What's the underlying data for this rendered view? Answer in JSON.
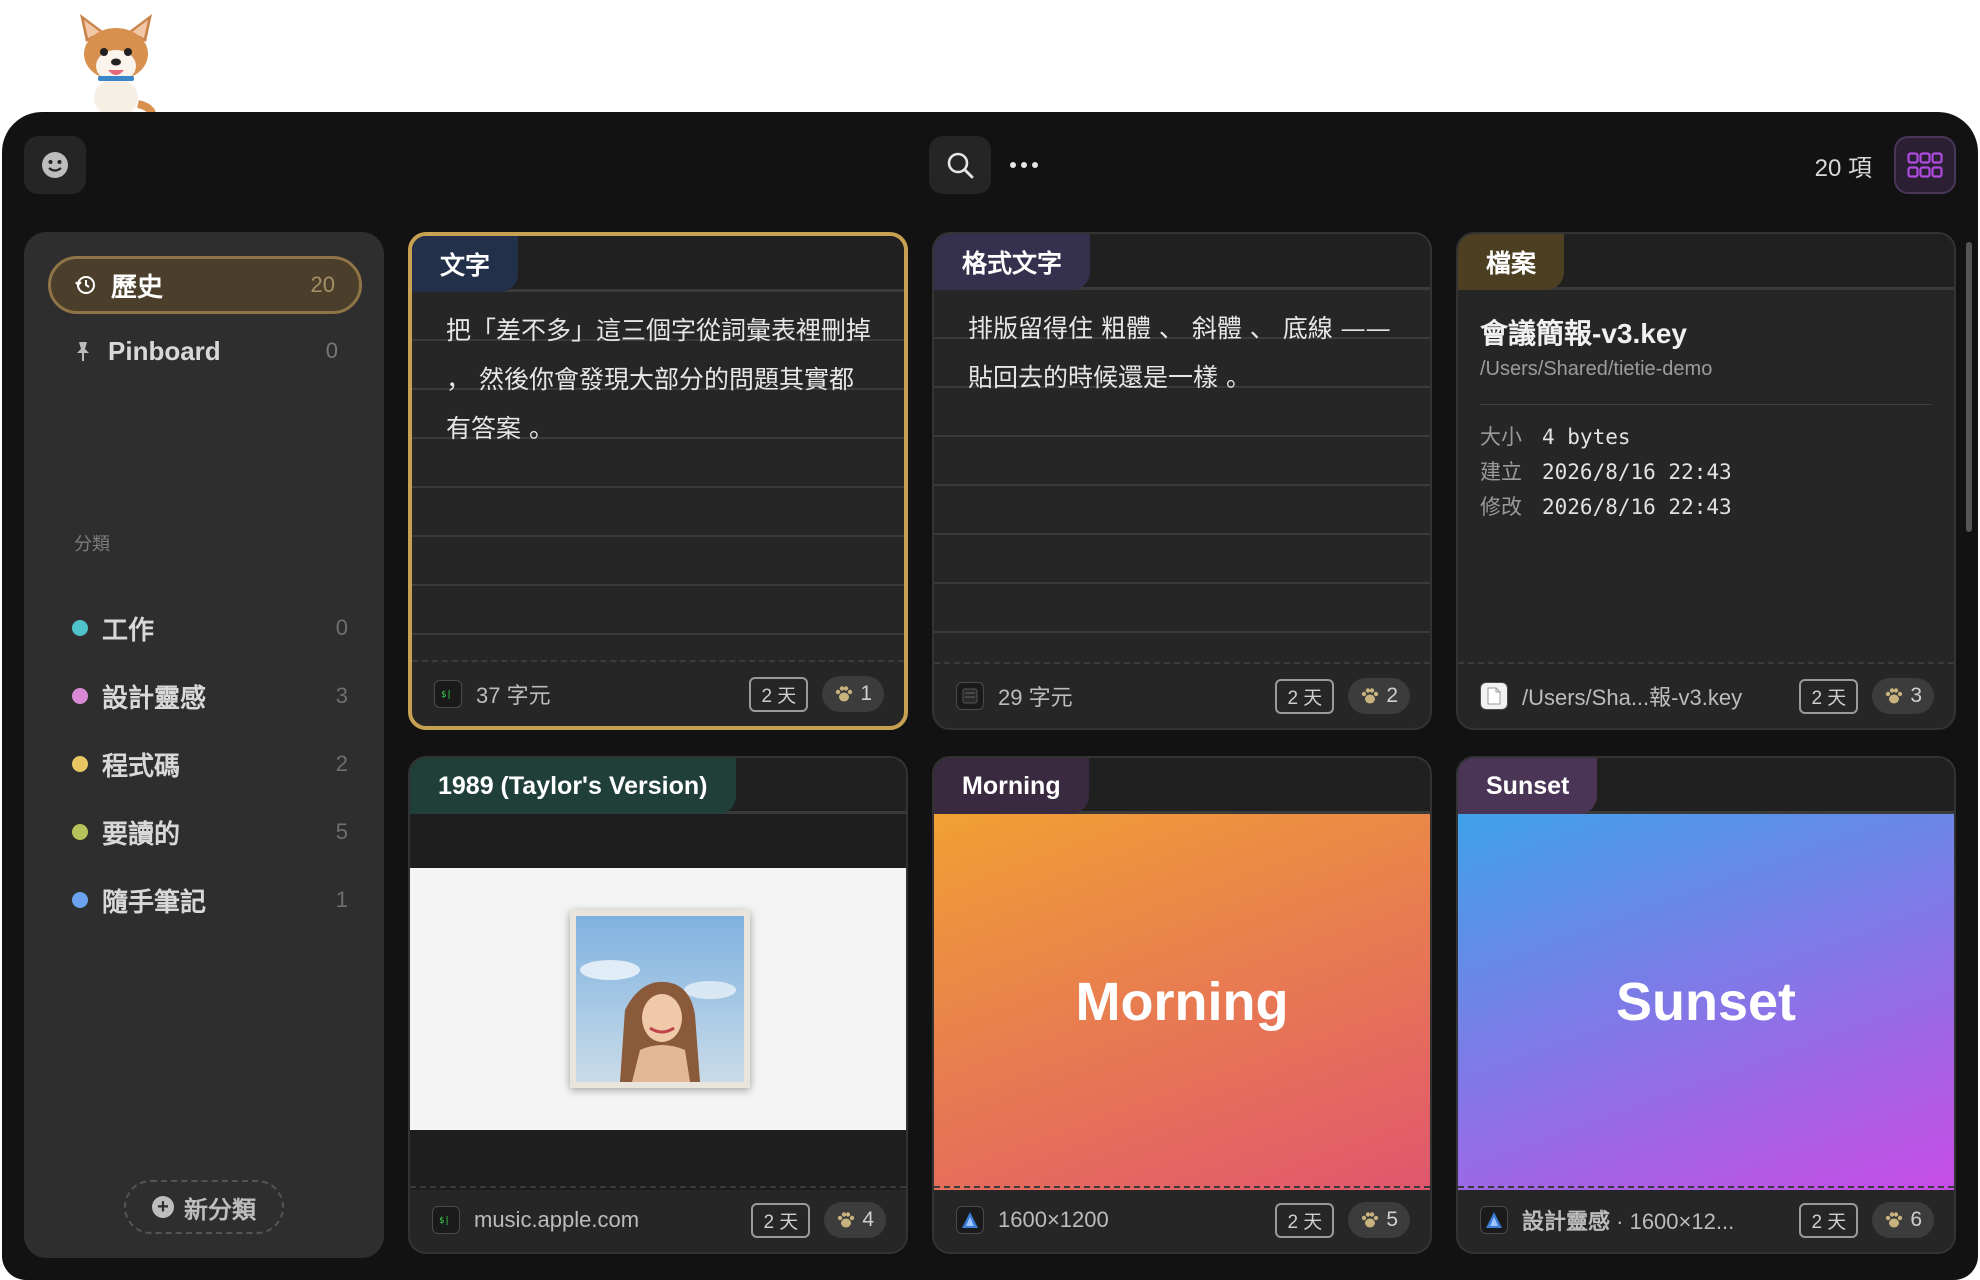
{
  "toolbar": {
    "item_count": "20 項"
  },
  "sidebar": {
    "history": {
      "label": "歷史",
      "count": "20"
    },
    "pinboard": {
      "label": "Pinboard",
      "count": "0"
    },
    "section_title": "分類",
    "categories": [
      {
        "label": "工作",
        "count": "0",
        "color": "#4fc3c9"
      },
      {
        "label": "設計靈感",
        "count": "3",
        "color": "#d98ad6"
      },
      {
        "label": "程式碼",
        "count": "2",
        "color": "#e8c463"
      },
      {
        "label": "要讀的",
        "count": "5",
        "color": "#b6c25a"
      },
      {
        "label": "隨手筆記",
        "count": "1",
        "color": "#6aa2ef"
      }
    ],
    "new_category": "新分類"
  },
  "cards": [
    {
      "tag": "文字",
      "tag_color": "#223049",
      "text": "把「差不多」這三個字從詞彙表裡刪掉 ， 然後你會發現大部分的問題其實都有答案 。",
      "foot": "37 字元",
      "age": "2 天",
      "paws": "1"
    },
    {
      "tag": "格式文字",
      "tag_color": "#34304d",
      "text": "排版留得住 粗體 、 斜體 、 底線 —— 貼回去的時候還是一樣 。",
      "foot": "29 字元",
      "age": "2 天",
      "paws": "2"
    },
    {
      "tag": "檔案",
      "tag_color": "#4d4022",
      "title": "會議簡報-v3.key",
      "path": "/Users/Shared/tietie-demo",
      "size_label": "大小",
      "size": "4 bytes",
      "created_label": "建立",
      "created": "2026/8/16 22:43",
      "modified_label": "修改",
      "modified": "2026/8/16 22:43",
      "foot": "/Users/Sha...報-v3.key",
      "age": "2 天",
      "paws": "3"
    },
    {
      "tag": "1989 (Taylor's Version)",
      "tag_color": "#1f3f38",
      "foot": "music.apple.com",
      "age": "2 天",
      "paws": "4"
    },
    {
      "tag": "Morning",
      "tag_color": "#3a2a40",
      "word": "Morning",
      "foot": "1600×1200",
      "age": "2 天",
      "paws": "5"
    },
    {
      "tag": "Sunset",
      "tag_color": "#4a3556",
      "word": "Sunset",
      "foot_category": "設計靈感",
      "foot": "· 1600×12...",
      "age": "2 天",
      "paws": "6"
    }
  ],
  "colors": {
    "accent_selected": "#c8a052",
    "grid_button": "#b04be0",
    "morning_gradient": [
      "#f0a034",
      "#e0566e"
    ],
    "sunset_gradient": [
      "#3fa2e8",
      "#c84ce6"
    ]
  }
}
